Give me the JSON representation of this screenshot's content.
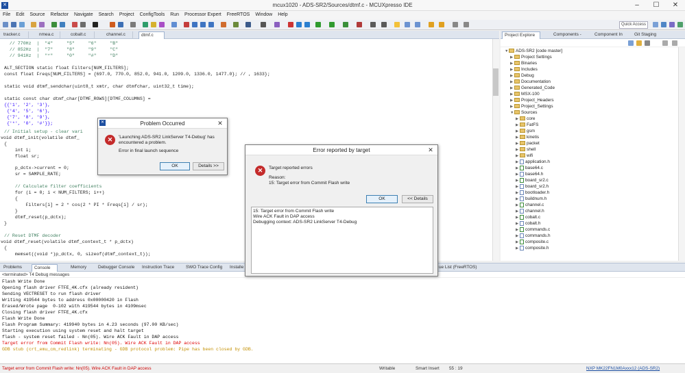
{
  "window": {
    "title": "mcux1020 - ADS-SR2/Sources/dtmf.c - MCUXpresso IDE",
    "min": "–",
    "max": "☐",
    "close": "✕"
  },
  "menu": [
    "File",
    "Edit",
    "Source",
    "Refactor",
    "Navigate",
    "Search",
    "Project",
    "ConfigTools",
    "Run",
    "Processor Expert",
    "FreeRTOS",
    "Window",
    "Help"
  ],
  "toolbar": {
    "quick_access": "Quick Access"
  },
  "editor_tabs": [
    "tracker.c",
    "nmea.c",
    "cobalt.c",
    "channel.c",
    "dtmf.c"
  ],
  "code": {
    "l1": "  // 770Hz  |  \"4\"     \"5\"     \"6\"     \"B\"",
    "l2": "  // 852Hz  |  \"7\"     \"8\"     \"9\"     \"C\"",
    "l3": "  // 941Hz  |  \"*\"     \"0\"     \"#\"     \"D\"",
    "l4": "ALT_SECTION static float Filters[NUM_FILTERS];",
    "l5": "const float Freqs[NUM_FILTERS] = {697.0, 770.0, 852.0, 941.0, 1209.0, 1336.0, 1477.0}; // , 1633};",
    "l6": "static void dtmf_sendchar(uint8_t xmtr, char dtmfchar, uint32_t time);",
    "l7": "static const char dtmf_char[DTMF_ROWS][DTMF_COLUMNS] =",
    "l8": "{{'1', '2', '3'},",
    "l9": " {'4', '5', '6'},",
    "l10": " {'7', '8', '9'},",
    "l11": " {'*', '0', '#'}};",
    "l12": "// Initial setup - clear vari",
    "l13": "void dtmf_init(volatile dtmf_",
    "l14": "{",
    "l15": "    int i;",
    "l16": "    float sr;",
    "l17": "    p_dctx->current = 0;",
    "l18": "    sr = SAMPLE_RATE;",
    "l19": "    // Calculate filter coefficients",
    "l20": "    for (i = 0; i < NUM_FILTERS; i++)",
    "l21": "    {",
    "l22": "        Filters[i] = 2 * cos(2 * PI * Freqs[i] / sr);",
    "l23": "    }",
    "l24": "    dtmf_reset(p_dctx);",
    "l25": "}",
    "l26": "// Reset DTMF decoder",
    "l27": "void dtmf_reset(volatile dtmf_context_t * p_dctx)",
    "l28": "{",
    "l29": "    memset((void *)p_dctx, 0, sizeof(dtmf_context_t));"
  },
  "project_tabs": [
    "Project Explore",
    "Components -",
    "Component In",
    "Git Staging"
  ],
  "project": {
    "root": "ADS-SR2 [code master]",
    "items": [
      "Project Settings",
      "Binaries",
      "Includes",
      "Debug",
      "Documentation",
      "Generated_Code",
      "MSX-100",
      "Project_Headers",
      "Project_Settings",
      "Sources"
    ],
    "sources": [
      "core",
      "FatFS",
      "gsm",
      "kinetis",
      "packet",
      "shell",
      "wifi",
      "application.h",
      "base64.c",
      "base64.h",
      "board_sr2.c",
      "board_sr2.h",
      "bootloader.h",
      "buildnum.h",
      "channel.c",
      "channel.h",
      "cobalt.c",
      "cobalt.h",
      "commands.c",
      "commands.h",
      "composite.c",
      "composite.h"
    ]
  },
  "console_tabs": [
    "Problems",
    "Console",
    "Memory",
    "Debugger Console",
    "Instruction Trace",
    "SWO Trace Config",
    "Installe",
    "ue List (FreeRTOS)"
  ],
  "console_title": "<terminated> T4 Debug messages",
  "console_lines": [
    "Flash Write Done",
    "Opening flash driver FTFE_4K.cfx (already resident)",
    "Sending VECTRESET to run flash driver",
    "Writing 419544 bytes to address 0x00000420 in Flash",
    "Erased/Wrote page  0-102 with 419544 bytes in 4109msec",
    "Closing flash driver FTFE_4K.cfx",
    "Flash Write Done",
    "Flash Program Summary: 419940 bytes in 4.23 seconds (97.00 KB/sec)",
    "Starting execution using system reset and halt target",
    "flash - system reset failed - Nn(05). Wire ACK Fault in DAP access"
  ],
  "console_errors": [
    "Target error from Commit Flash write: Nn(05). Wire ACK Fault in DAP access",
    "GDB stub (crt_emu_cm_redlink) terminating - GDB protocol problem: Pipe has been closed by GDB."
  ],
  "status": {
    "message": "Target error from Commit Flash write: Nn(05). Wire ACK Fault in DAP access",
    "writable": "Writable",
    "insert": "Smart Insert",
    "position": "55 : 19",
    "device": "NXP MK22FN1M0Axxx12 (ADS-SR2)"
  },
  "dialog1": {
    "title": "Problem Occurred",
    "message1": "'Launching ADS-SR2 LinkServer T4-Debug' has",
    "message2": "encountered a problem.",
    "message3": "Error in final launch sequence",
    "ok": "OK",
    "details": "Details >>"
  },
  "dialog2": {
    "title": "Error reported by target",
    "message1": "Target reported errors",
    "reason_label": "Reason:",
    "reason": "15: Target error from Commit Flash write",
    "ok": "OK",
    "details": "<< Details",
    "details_lines": [
      "15: Target error from Commit Flash write",
      "Wire ACK Fault in DAP access",
      "Debugging context: ADS-SR2 LinkServer T4-Debug"
    ]
  }
}
